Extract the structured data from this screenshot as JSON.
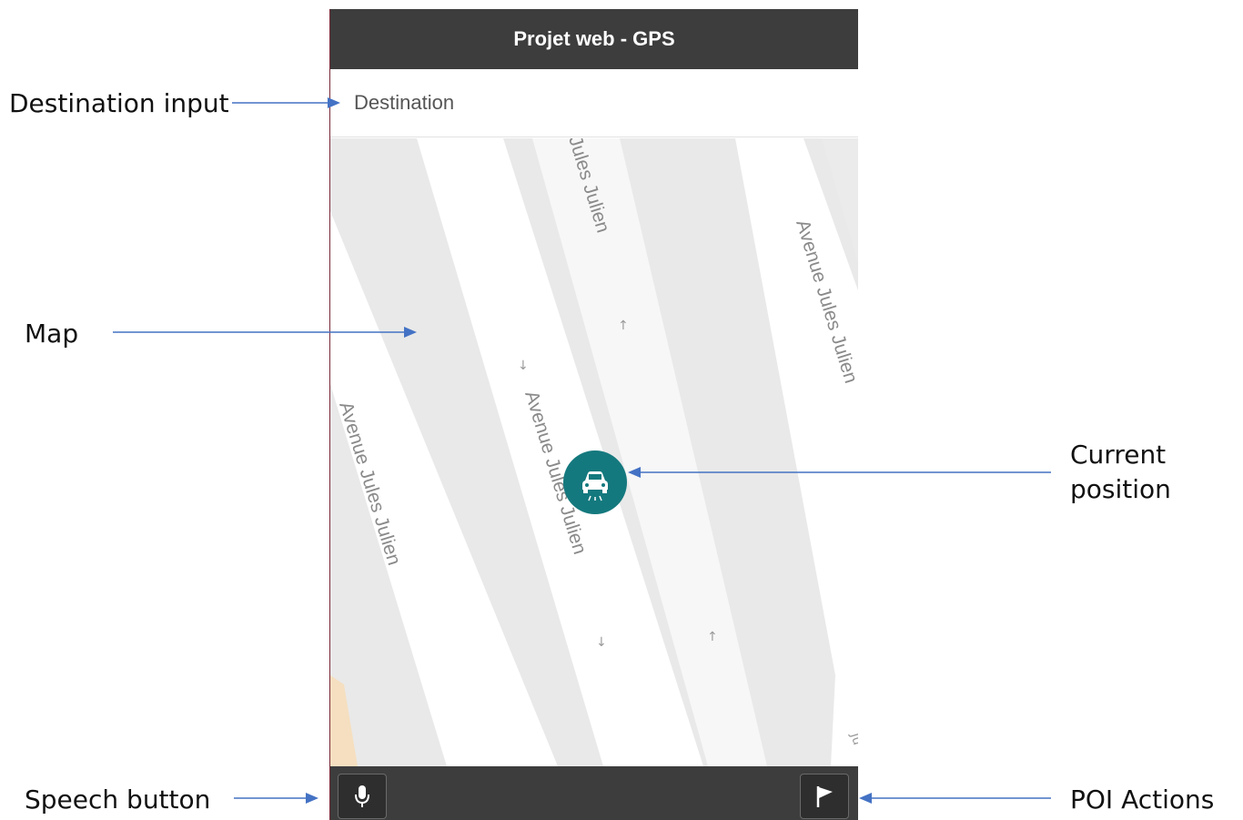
{
  "app": {
    "title": "Projet web - GPS",
    "destination_placeholder": "Destination",
    "destination_value": ""
  },
  "map": {
    "street_labels": [
      "Jules Julien",
      "Avenue Jules Julien",
      "Avenue Jules Julien",
      "Avenue Jules Julien"
    ],
    "oneway_arrow_up": "↑",
    "oneway_arrow_down": "↓",
    "marker_icon": "car-icon"
  },
  "toolbar": {
    "speech_icon": "microphone-icon",
    "poi_icon": "flag-icon"
  },
  "annotations": {
    "destination_input": "Destination input",
    "map": "Map",
    "current_position_line1": "Current",
    "current_position_line2": "position",
    "speech_button": "Speech button",
    "poi_actions": "POI Actions"
  },
  "colors": {
    "bar": "#3d3d3d",
    "marker": "#14797e",
    "map_bg": "#e9e9e9",
    "road": "#ffffff",
    "annotation_arrow": "#4472c4"
  }
}
